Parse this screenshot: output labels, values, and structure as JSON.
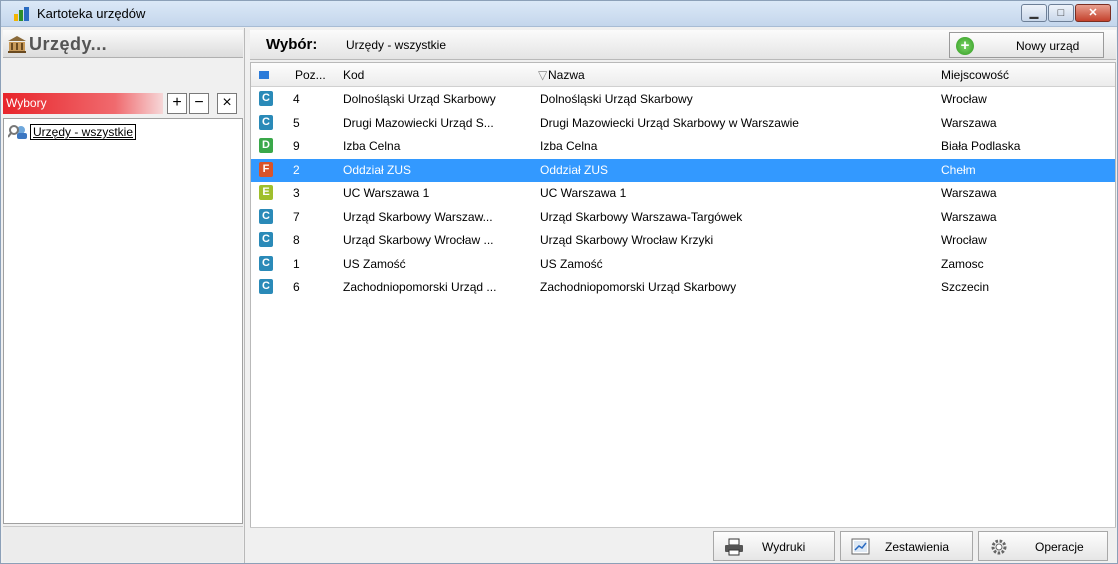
{
  "window": {
    "title": "Kartoteka urzędów"
  },
  "left": {
    "header_title": "Urzędy...",
    "wybory_label": "Wybory",
    "add": "+",
    "remove": "−",
    "close": "×",
    "tree_item": "Urzędy - wszystkie"
  },
  "right": {
    "wybor_label": "Wybór:",
    "wybor_value": "Urzędy - wszystkie",
    "new_button": "Nowy urząd"
  },
  "columns": {
    "poz": "Poz...",
    "kod": "Kod",
    "nazwa": "Nazwa",
    "miejscowosc": "Miejscowość",
    "sort_glyph": "▽"
  },
  "rows": [
    {
      "badge": "C",
      "badge_color": "#2a8ab8",
      "poz": "4",
      "kod": "Dolnośląski Urząd Skarbowy",
      "nazwa": "Dolnośląski Urząd Skarbowy",
      "miejscowosc": "Wrocław"
    },
    {
      "badge": "C",
      "badge_color": "#2a8ab8",
      "poz": "5",
      "kod": "Drugi Mazowiecki Urząd S...",
      "nazwa": "Drugi Mazowiecki Urząd Skarbowy w Warszawie",
      "miejscowosc": "Warszawa"
    },
    {
      "badge": "D",
      "badge_color": "#3aa84a",
      "poz": "9",
      "kod": "Izba Celna",
      "nazwa": "Izba Celna",
      "miejscowosc": "Biała Podlaska"
    },
    {
      "badge": "F",
      "badge_color": "#d9542a",
      "poz": "2",
      "kod": "Oddział ZUS",
      "nazwa": "Oddział ZUS",
      "miejscowosc": "Chełm",
      "selected": true
    },
    {
      "badge": "E",
      "badge_color": "#9fbf2c",
      "poz": "3",
      "kod": "UC Warszawa 1",
      "nazwa": "UC Warszawa 1",
      "miejscowosc": "Warszawa"
    },
    {
      "badge": "C",
      "badge_color": "#2a8ab8",
      "poz": "7",
      "kod": "Urząd Skarbowy Warszaw...",
      "nazwa": "Urząd Skarbowy Warszawa-Targówek",
      "miejscowosc": "Warszawa"
    },
    {
      "badge": "C",
      "badge_color": "#2a8ab8",
      "poz": "8",
      "kod": "Urząd Skarbowy Wrocław ...",
      "nazwa": "Urząd Skarbowy Wrocław Krzyki",
      "miejscowosc": "Wrocław"
    },
    {
      "badge": "C",
      "badge_color": "#2a8ab8",
      "poz": "1",
      "kod": "US Zamość",
      "nazwa": "US Zamość",
      "miejscowosc": "Zamosc"
    },
    {
      "badge": "C",
      "badge_color": "#2a8ab8",
      "poz": "6",
      "kod": "Zachodniopomorski Urząd ...",
      "nazwa": "Zachodniopomorski Urząd Skarbowy",
      "miejscowosc": "Szczecin"
    }
  ],
  "bottom": {
    "wydruki": "Wydruki",
    "zestawienia": "Zestawienia",
    "operacje": "Operacje"
  }
}
